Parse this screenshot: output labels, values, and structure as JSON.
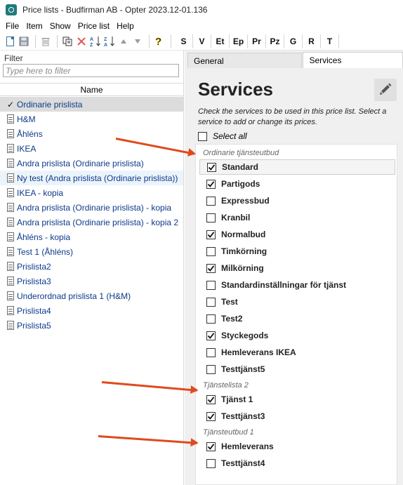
{
  "window": {
    "title": "Price lists - Budfirman AB - Opter 2023.12-01.136"
  },
  "menu": [
    "File",
    "Item",
    "Show",
    "Price list",
    "Help"
  ],
  "toolbar": {
    "icons": [
      "new-document-icon",
      "save-icon",
      "delete-icon",
      "copy-icon",
      "close-icon",
      "sort-ascending-icon",
      "sort-descending-icon",
      "move-up-icon",
      "move-down-icon",
      "help-icon"
    ],
    "letters": [
      "S",
      "V",
      "Et",
      "Ep",
      "Pr",
      "Pz",
      "G",
      "R",
      "T"
    ]
  },
  "filter": {
    "label": "Filter",
    "placeholder": "Type here to filter",
    "value": ""
  },
  "list": {
    "column_header": "Name",
    "items": [
      {
        "label": "Ordinarie prislista",
        "state": "selected",
        "icon": "check-icon"
      },
      {
        "label": "H&M",
        "icon": "document-icon"
      },
      {
        "label": "Åhléns",
        "icon": "document-icon"
      },
      {
        "label": "IKEA",
        "icon": "document-icon"
      },
      {
        "label": "Andra prislista (Ordinarie prislista)",
        "icon": "document-icon"
      },
      {
        "label": "Ny test (Andra prislista (Ordinarie prislista))",
        "state": "hover",
        "icon": "document-icon"
      },
      {
        "label": "IKEA - kopia",
        "icon": "document-icon"
      },
      {
        "label": "Andra prislista (Ordinarie prislista) - kopia",
        "icon": "document-icon"
      },
      {
        "label": "Andra prislista (Ordinarie prislista) - kopia 2",
        "icon": "document-icon"
      },
      {
        "label": "Åhléns - kopia",
        "icon": "document-icon"
      },
      {
        "label": "Test 1 (Åhléns)",
        "icon": "document-icon"
      },
      {
        "label": "Prislista2",
        "icon": "document-icon"
      },
      {
        "label": "Prislista3",
        "icon": "document-icon"
      },
      {
        "label": "Underordnad prislista 1 (H&M)",
        "icon": "document-icon"
      },
      {
        "label": "Prislista4",
        "icon": "document-icon"
      },
      {
        "label": "Prislista5",
        "icon": "document-icon"
      }
    ]
  },
  "tabs": [
    {
      "label": "General",
      "active": false
    },
    {
      "label": "Services",
      "active": true
    }
  ],
  "services": {
    "heading": "Services",
    "edit_icon": "pencil-icon",
    "instructions": "Check the services to be used in this price list. Select a service to add or change its prices.",
    "select_all": {
      "label": "Select all",
      "checked": false
    },
    "groups": [
      {
        "name": "Ordinarie tjänsteutbud",
        "items": [
          {
            "label": "Standard",
            "checked": true,
            "focused": true
          },
          {
            "label": "Partigods",
            "checked": true
          },
          {
            "label": "Expressbud",
            "checked": false
          },
          {
            "label": "Kranbil",
            "checked": false
          },
          {
            "label": "Normalbud",
            "checked": true
          },
          {
            "label": "Timkörning",
            "checked": false
          },
          {
            "label": "Milkörning",
            "checked": true
          },
          {
            "label": "Standardinställningar för tjänst",
            "checked": false
          },
          {
            "label": "Test",
            "checked": false
          },
          {
            "label": "Test2",
            "checked": false
          },
          {
            "label": "Styckegods",
            "checked": true
          },
          {
            "label": "Hemleverans IKEA",
            "checked": false
          },
          {
            "label": "Testtjänst5",
            "checked": false
          }
        ]
      },
      {
        "name": "Tjänstelista 2",
        "items": [
          {
            "label": "Tjänst 1",
            "checked": true
          },
          {
            "label": "Testtjänst3",
            "checked": true
          }
        ]
      },
      {
        "name": "Tjänsteutbud 1",
        "items": [
          {
            "label": "Hemleverans",
            "checked": true
          },
          {
            "label": "Testtjänst4",
            "checked": false
          }
        ]
      }
    ]
  },
  "colors": {
    "annotation_arrow": "#e04a1c",
    "list_text": "#0d3a8a",
    "selected_row": "#dcdcdc",
    "hover_row": "#ecf4fb"
  }
}
